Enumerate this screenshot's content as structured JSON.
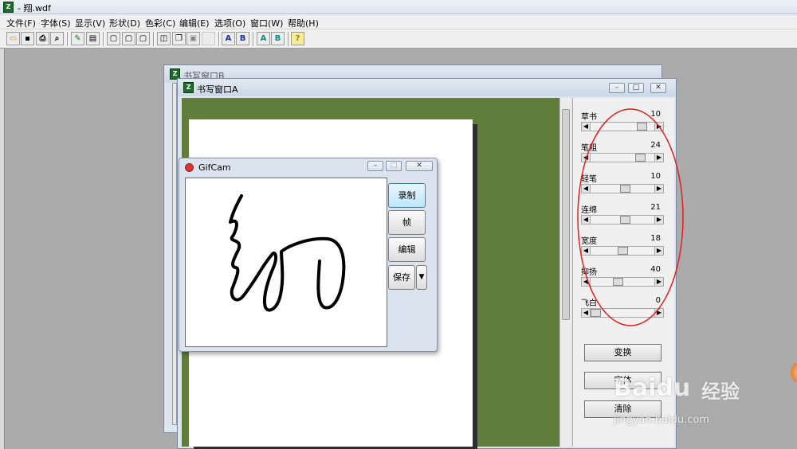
{
  "app": {
    "title": "- 翔.wdf",
    "icon": "app-icon"
  },
  "menu": [
    "文件(F)",
    "字体(S)",
    "显示(V)",
    "形状(D)",
    "色彩(C)",
    "编辑(E)",
    "选项(O)",
    "窗口(W)",
    "帮助(H)"
  ],
  "toolbar": {
    "icons": [
      "open-icon",
      "save-icon",
      "print-icon",
      "print-preview-icon",
      "pen-icon",
      "frame-icon",
      "layout1-icon",
      "layout2-icon",
      "layout3-icon",
      "window-icon",
      "copy-icon",
      "paste-icon",
      "blank-icon",
      "font-a-icon",
      "font-b-icon",
      "color-a-icon",
      "color-b-icon",
      "help-icon"
    ],
    "labels": {
      "font_a": "A",
      "font_b": "B",
      "color_a": "A",
      "color_b": "B",
      "help": "?"
    }
  },
  "window_b": {
    "title": "书写窗口B"
  },
  "window_a": {
    "title": "书写窗口A"
  },
  "params": [
    {
      "label": "草书",
      "value": "10",
      "level": 0.87
    },
    {
      "label": "笔粗",
      "value": "24",
      "level": 0.83
    },
    {
      "label": "轻笔",
      "value": "10",
      "level": 0.55
    },
    {
      "label": "连绵",
      "value": "21",
      "level": 0.55
    },
    {
      "label": "宽度",
      "value": "18",
      "level": 0.5
    },
    {
      "label": "抑扬",
      "value": "40",
      "level": 0.42
    },
    {
      "label": "飞白",
      "value": "0",
      "level": 0.0
    }
  ],
  "buttons": {
    "transform": "变换",
    "font": "字体",
    "clear": "清除"
  },
  "gifcam": {
    "title": "GifCam",
    "record": "录制",
    "frame": "帧",
    "edit": "编辑",
    "save": "保存"
  },
  "watermark": {
    "brand": "Baidu",
    "brand_cn": "经验",
    "url": "jingyan.baidu.com"
  },
  "colors": {
    "canvas_bg": "#607d3c",
    "annotation": "#e02020",
    "ink": "#000000"
  }
}
